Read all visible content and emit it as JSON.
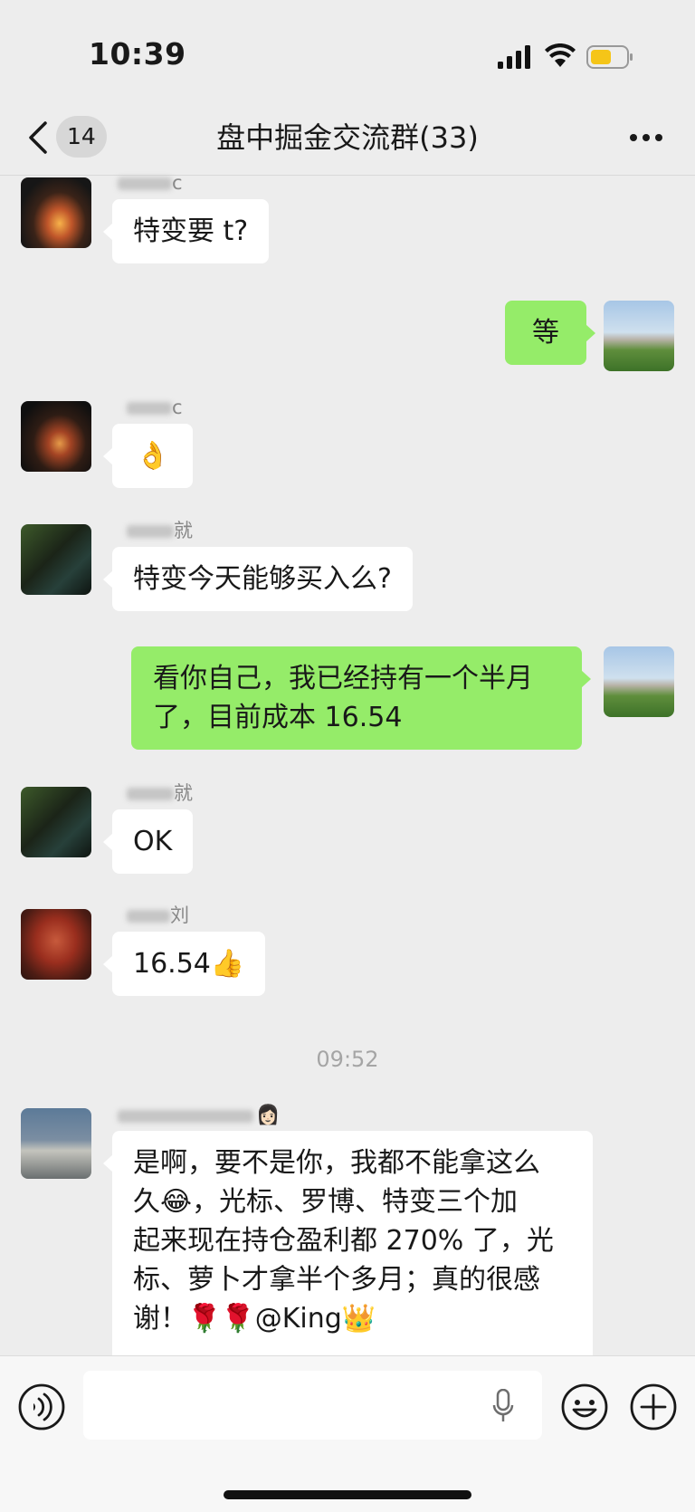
{
  "status_bar": {
    "time": "10:39"
  },
  "nav": {
    "back_badge": "14",
    "title": "盘中掘金交流群(33)"
  },
  "messages": [
    {
      "side": "in",
      "name": "c",
      "text": "特变要 t?"
    },
    {
      "side": "out",
      "text": "等"
    },
    {
      "side": "in",
      "name": "c",
      "text": "👌"
    },
    {
      "side": "in",
      "name": "就",
      "text": "特变今天能够买入么?"
    },
    {
      "side": "out",
      "text_lines": [
        "看你自己，我已经持有一个半月",
        "了，目前成本 16.54"
      ]
    },
    {
      "side": "in",
      "name": "就",
      "text": "OK"
    },
    {
      "side": "in",
      "name": "刘",
      "text": "16.54👍"
    },
    {
      "side": "in",
      "name": "👩🏻",
      "text_lines": [
        "是啊，要不是你，我都不能拿这么",
        "久😂，光标、罗博、特变三个加",
        "起来现在持仓盈利都 270% 了，光",
        "标、萝卜才拿半个多月；真的很感",
        "谢！🌹🌹@King👑"
      ]
    }
  ],
  "timestamp": "09:52",
  "input_bar": {
    "placeholder": ""
  }
}
